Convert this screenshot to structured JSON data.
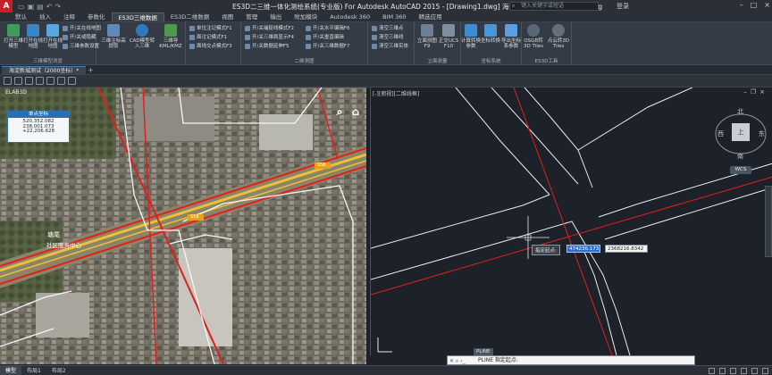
{
  "titlebar": {
    "logo": "A",
    "title": "ES3D二三维一体化测绘系统(专业版) For Autodesk AutoCAD 2015 - [Drawing1.dwg]      海淀新城测试（2000坐标）.dwg",
    "search_placeholder": "键入关键字或短语",
    "login": "登录"
  },
  "tabs": [
    "默认",
    "插入",
    "注释",
    "参数化",
    "ES3D三维数据",
    "ES3D二维数据",
    "视图",
    "管理",
    "输出",
    "附加模块",
    "Autodesk 360",
    "BIM 360",
    "精选应用"
  ],
  "active_tab_index": 4,
  "ribbon": {
    "group1": {
      "label": "三维模型浏览",
      "big_buttons": [
        "打开三维模型",
        "打开在线地图",
        "打开在线地图"
      ],
      "small_buttons": [
        "开/关在线地图",
        "开/关或隐藏",
        "三维参数设置"
      ]
    },
    "group2": {
      "label": "",
      "big_buttons": [
        "三维注标高提取",
        "CAD模型转入三维",
        "三维导KML/KMZ"
      ]
    },
    "group3": {
      "label": "",
      "small_buttons": [
        "单位注记模式F1",
        "面注记模式F1",
        "面线交点模式F3"
      ]
    },
    "group4": {
      "label": "二维测图",
      "small_buttons": [
        "开/关捕捉线模式F2",
        "开/关三维面显示F4",
        "开/关数据延伸F5",
        "开/关水平编辑F6",
        "开/关垂直编辑",
        "开/关三维数据F7"
      ]
    },
    "group5": {
      "label": "",
      "small_buttons": [
        "清空三维点",
        "清空三维线",
        "清空三维实体"
      ]
    },
    "group6": {
      "label": "立面测量",
      "big_buttons": [
        "立面测图F9",
        "正交UCS F10"
      ]
    },
    "group7": {
      "label": "坐标系统",
      "big_buttons": [
        "计算转换参数",
        "坐标转换",
        "导出坐标系参数"
      ]
    },
    "group8": {
      "label": "ES3D工具",
      "big_buttons": [
        "OSGB转3D Tiles",
        "点云转3D Tiles"
      ]
    }
  },
  "doc_tab": "海淀新城测试（2000坐标）*",
  "left_viewport": {
    "title": "ELAB3D",
    "coord_box": {
      "header": "单点坐标",
      "lines": [
        "520,352.082",
        "238,001.073",
        "+22,206.628"
      ]
    },
    "map_labels": [
      "塘尾",
      "社区服务中心",
      "S58",
      "S58"
    ]
  },
  "right_viewport": {
    "title": "[-][俯视][二维线框]",
    "compass": {
      "north": "北",
      "south": "南",
      "east": "东",
      "west": "西",
      "cube": "上"
    },
    "wcs": "WCS",
    "prompt_label": "指定起点:",
    "input_x": "474236.173",
    "input_y": "2368216.8342"
  },
  "command": {
    "tip": "PLINE",
    "text": "PLINE 指定起点:"
  },
  "status_tabs": [
    "模型",
    "布局1",
    "布局2"
  ],
  "colors": {
    "accent": "#2a6fb5",
    "road_red": "#e0201c",
    "road_yellow": "#e8c23a",
    "cad_bg": "#1d2129"
  }
}
